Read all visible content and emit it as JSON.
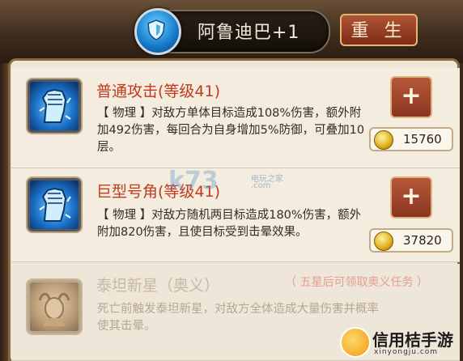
{
  "header": {
    "hero_name": "阿鲁迪巴+1",
    "rebirth_label": "重 生"
  },
  "skills": [
    {
      "title": "普通攻击(等级41)",
      "description": "【 物理 】对敌方单体目标造成108%伤害，额外附加492伤害，每回合为自身增加5%防御，可叠加10层。",
      "upgrade_label": "+",
      "cost": "15760",
      "icon": "fist-icon"
    },
    {
      "title": "巨型号角(等级41)",
      "description": "【 物理 】对敌方随机两目标造成180%伤害，额外附加820伤害，且使目标受到击晕效果。",
      "upgrade_label": "+",
      "cost": "37820",
      "icon": "fist-icon"
    },
    {
      "title": "泰坦新星（奥义）",
      "unlock_hint": "（ 五星后可领取奥义任务 ）",
      "description": "死亡前触发泰坦新星，对敌方全体造成大量伤害并概率使其击晕。",
      "icon": "titan-portrait-icon"
    }
  ],
  "watermarks": {
    "k73": "k73",
    "k73_sub": "电玩之家",
    "k73_url": ".com",
    "brand": "信用桔手游",
    "brand_url": "xinyongju.com"
  },
  "colors": {
    "title_red": "#c13a1d",
    "button_red": "#9a3e25",
    "panel_bg": "#efe6d6"
  }
}
